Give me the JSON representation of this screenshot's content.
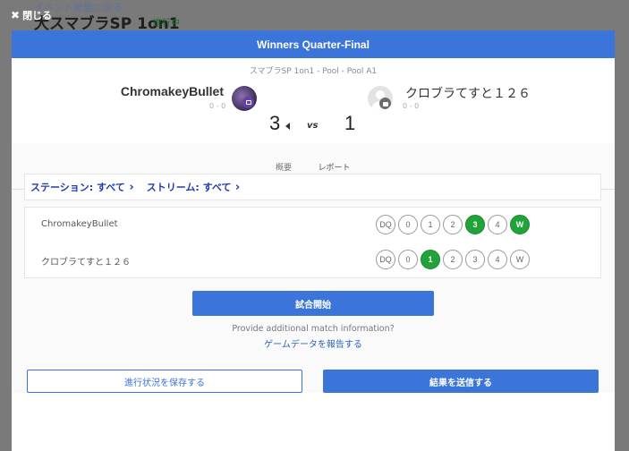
{
  "background": {
    "breadcrumb": "イベント概要に戻る",
    "title": "大スマブラSP 1on1",
    "status": "進行中"
  },
  "close_label": "閉じる",
  "modal": {
    "header": "Winners Quarter-Final",
    "bracket": "スマブラSP 1on1 - Pool - Pool A1",
    "player1": {
      "name": "ChromakeyBullet",
      "record": "0 - 0",
      "score": "3"
    },
    "vs": "vs",
    "player2": {
      "name": "クロブラてすと１２６",
      "record": "0 - 0",
      "score": "1"
    },
    "tabs": {
      "overview": "概要",
      "report": "レポート"
    },
    "filters": {
      "station": "ステーション: すべて",
      "stream": "ストリーム: すべて"
    },
    "report_rows": [
      {
        "name": "ChromakeyBullet",
        "options": [
          "DQ",
          "0",
          "1",
          "2",
          "3",
          "4",
          "W"
        ],
        "selected": [
          "3",
          "W"
        ]
      },
      {
        "name": "クロブラてすと１２６",
        "options": [
          "DQ",
          "0",
          "1",
          "2",
          "3",
          "4",
          "W"
        ],
        "selected": [
          "1"
        ]
      }
    ],
    "start_button": "試合開始",
    "info_text": "Provide additional match information?",
    "info_link": "ゲームデータを報告する",
    "save_button": "進行状況を保存する",
    "submit_button": "結果を送信する"
  },
  "colors": {
    "accent": "#3b75d9",
    "selected": "#22a33a",
    "tab_indicator": "#e0407a"
  }
}
